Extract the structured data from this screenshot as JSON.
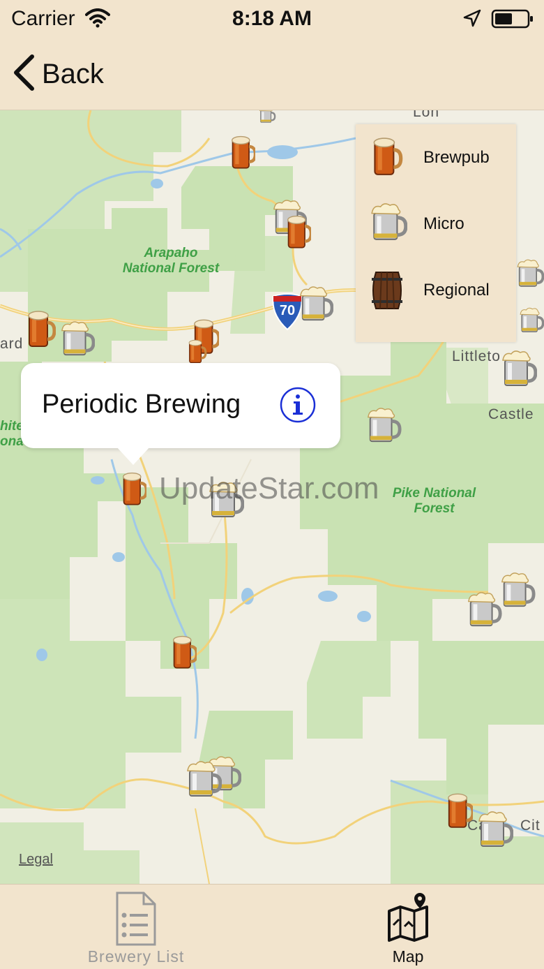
{
  "status_bar": {
    "carrier": "Carrier",
    "time": "8:18 AM"
  },
  "nav_bar": {
    "back_label": "Back"
  },
  "legend": {
    "items": [
      {
        "label": "Brewpub",
        "icon": "brewpub-mug-icon"
      },
      {
        "label": "Micro",
        "icon": "micro-tankard-icon"
      },
      {
        "label": "Regional",
        "icon": "regional-barrel-icon"
      }
    ]
  },
  "callout": {
    "title": "Periodic Brewing",
    "button_icon": "info-icon"
  },
  "map": {
    "labels": {
      "arapaho": "Arapaho\nNational Forest",
      "pike": "Pike National\nForest",
      "littleton": "Littleto",
      "castle": "Castle",
      "ard": "ard",
      "white": "hite\nona",
      "city": "Cit",
      "ca": "Ca",
      "lon": "Lon",
      "highway": "70"
    },
    "legal": "Legal",
    "watermark": "UpdateStar.com"
  },
  "tab_bar": {
    "tabs": [
      {
        "label": "Brewery List",
        "icon": "list-document-icon",
        "selected": false
      },
      {
        "label": "Map",
        "icon": "folded-map-icon",
        "selected": true
      }
    ]
  },
  "colors": {
    "bar_background": "#f2e4cd",
    "forest_green": "#c9e2b3",
    "water_blue": "#9fc8e8",
    "road_yellow": "#f2d27a",
    "callout_info_blue": "#1a2fd6"
  }
}
